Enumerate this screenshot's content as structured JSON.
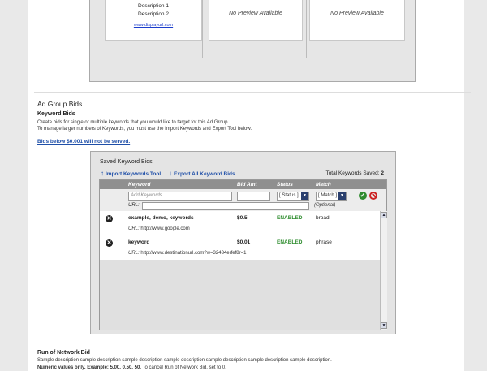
{
  "preview": {
    "col1": {
      "desc1": "Description 1",
      "desc2": "Description 2",
      "display_url": "www.displayurl.com"
    },
    "col2": {
      "text": "No Preview Available"
    },
    "col3": {
      "text": "No Preview Available"
    }
  },
  "ad_group_bids": {
    "title": "Ad Group Bids",
    "keyword_bids_title": "Keyword Bids",
    "intro_line1": "Create bids for single or multiple keywords that you would like to target for this Ad Group.",
    "intro_line2": "To manage larger numbers of Keywords, you must use the Import Keywords and Export Tool below.",
    "warning_link": "Bids below $0.001 will not be served."
  },
  "saved": {
    "title": "Saved Keyword Bids",
    "import_label": "Import Keywords Tool",
    "export_label": "Export All Keyword Bids",
    "total_label": "Total Keywords Saved:",
    "total_value": "2",
    "columns": {
      "keyword": "Keyword",
      "bid": "Bid Amt",
      "status": "Status",
      "match": "Match"
    },
    "filter": {
      "keyword_placeholder": "Add Keywords...",
      "status_select": "[ Status ]",
      "match_select": "[ Match ]",
      "url_label": "URL:",
      "optional": "(Optional)"
    },
    "rows": [
      {
        "keyword": "example, demo, keywords",
        "bid": "$0.5",
        "status": "ENABLED",
        "match": "broad",
        "url_label": "URL:",
        "url": "http://www.google.com"
      },
      {
        "keyword": "keyword",
        "bid": "$0.01",
        "status": "ENABLED",
        "match": "phrase",
        "url_label": "URL:",
        "url": "http://www.destinationurl.com?w=32434erfef8r=1"
      }
    ]
  },
  "run_of_network": {
    "title": "Run of Network Bid",
    "description": "Sample description sample description sample description sample description sample description sample description sample description.",
    "note_bold": "Numeric values only. Example: 5.00, 0.50, 50.",
    "note_rest": " To cancel Run of Network Bid, set to 0."
  }
}
